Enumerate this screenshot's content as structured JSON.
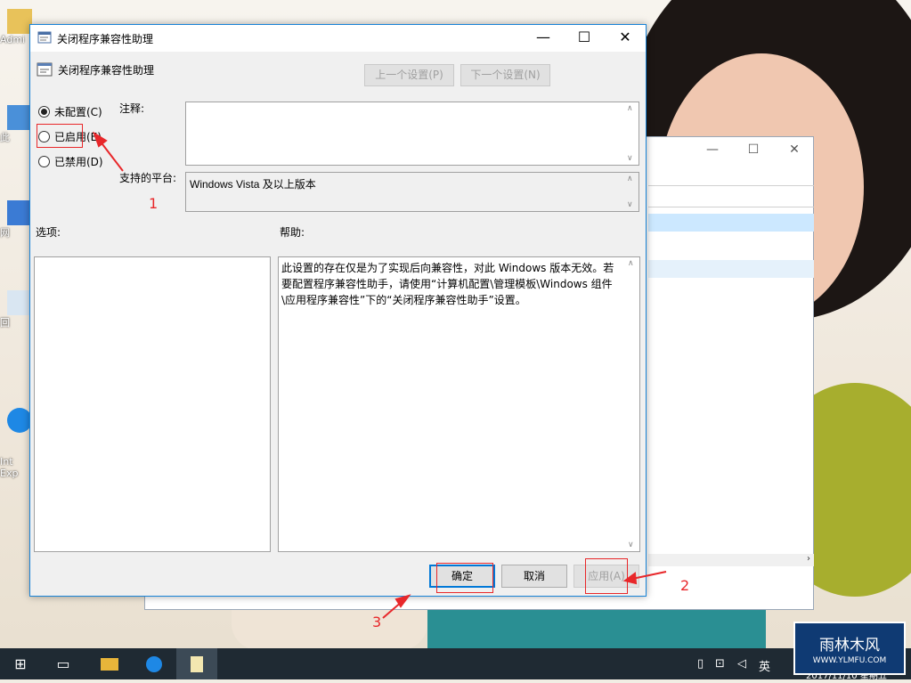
{
  "desktop": {
    "icons": [
      {
        "label": "Admi"
      },
      {
        "label": "此"
      },
      {
        "label": "网"
      },
      {
        "label": "回"
      },
      {
        "label": "Int\nExp"
      }
    ]
  },
  "dialog": {
    "title": "关闭程序兼容性助理",
    "window_controls": {
      "minimize": "—",
      "maximize": "☐",
      "close": "✕"
    },
    "header_title": "关闭程序兼容性助理",
    "prev_setting": "上一个设置(P)",
    "next_setting": "下一个设置(N)",
    "options": [
      {
        "label": "未配置(C)",
        "selected": true
      },
      {
        "label": "已启用(E)",
        "selected": false
      },
      {
        "label": "已禁用(D)",
        "selected": false
      }
    ],
    "comment_label": "注释:",
    "comment_value": "",
    "platform_label": "支持的平台:",
    "platform_value": "Windows Vista 及以上版本",
    "options_label": "选项:",
    "help_label": "帮助:",
    "help_text": "此设置的存在仅是为了实现后向兼容性，对此 Windows 版本无效。若要配置程序兼容性助手，请使用“计算机配置\\管理模板\\Windows 组件\\应用程序兼容性”下的“关闭程序兼容性助手”设置。",
    "ok": "确定",
    "cancel": "取消",
    "apply": "应用(A)"
  },
  "annotations": {
    "n1": "1",
    "n2": "2",
    "n3": "3"
  },
  "bg_window": {
    "controls": {
      "minimize": "—",
      "maximize": "☐",
      "close": "✕"
    }
  },
  "taskbar": {
    "start": "⊞",
    "task_view": "▭",
    "tray_ime": "英",
    "clock": "2017/11/10 星期五"
  },
  "watermark": {
    "title": "雨林木风",
    "url": "WWW.YLMFU.COM"
  },
  "colors": {
    "accent": "#0078d7",
    "annotation_red": "#e8272a",
    "taskbar": "#1f2a33"
  }
}
